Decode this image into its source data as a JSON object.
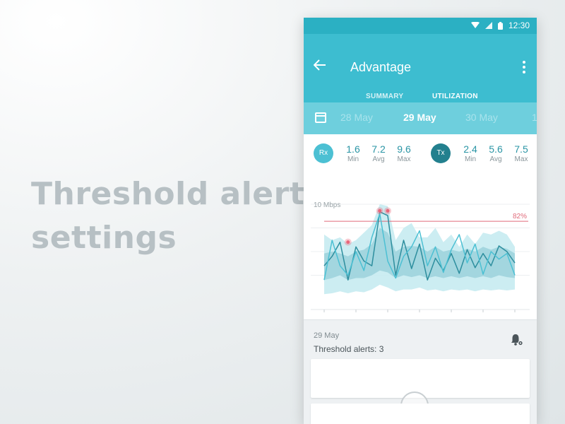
{
  "headline": {
    "line1": "Threshold alerts",
    "line2": "settings"
  },
  "status": {
    "time": "12:30",
    "icons": [
      "wifi-icon",
      "signal-icon",
      "battery-icon"
    ]
  },
  "appbar": {
    "title": "Advantage",
    "back_icon": "arrow-left-icon",
    "menu_icon": "more-vert-icon"
  },
  "tabs": [
    {
      "label": "SUMMARY",
      "active": false
    },
    {
      "label": "UTILIZATION",
      "active": true
    }
  ],
  "dates": {
    "prev": "28 May",
    "current": "29 May",
    "next": "30 May",
    "cut": "1"
  },
  "rx": {
    "badge": "Rx",
    "color": "#4cc0d3",
    "min": "1.6",
    "avg": "7.2",
    "max": "9.6"
  },
  "tx": {
    "badge": "Tx",
    "color": "#23808e",
    "min": "2.4",
    "avg": "5.6",
    "max": "7.5"
  },
  "stat_labels": {
    "min": "Min",
    "avg": "Avg",
    "max": "Max"
  },
  "chart_data": {
    "type": "area",
    "title": "",
    "ylabel": "10 Mbps",
    "x": [
      0,
      1,
      2,
      3,
      4,
      5,
      6,
      7,
      8,
      9,
      10,
      11,
      12,
      13,
      14,
      15,
      16,
      17,
      18,
      19,
      20,
      21,
      22,
      23,
      24
    ],
    "x_ticks": [
      0,
      4,
      8,
      12,
      16,
      20,
      24
    ],
    "ylim": [
      0,
      10
    ],
    "threshold": {
      "value": 8.2,
      "label": "82%",
      "color": "#e06a7a"
    },
    "series": [
      {
        "values": [
          3.5,
          4.5,
          6.0,
          2.0,
          5.5,
          4.0,
          3.5,
          9.2,
          8.8,
          2.5,
          6.2,
          3.2,
          5.8,
          2.0,
          4.3,
          3.0,
          4.8,
          2.7,
          5.2,
          3.3,
          4.8,
          3.5,
          5.6,
          5.0,
          3.8
        ]
      },
      {
        "values": [
          2.0,
          6.2,
          3.5,
          2.5,
          5.0,
          3.0,
          6.5,
          9.0,
          4.0,
          2.2,
          4.5,
          5.5,
          7.2,
          3.5,
          5.5,
          2.8,
          5.2,
          6.8,
          3.8,
          5.8,
          2.6,
          5.0,
          4.2,
          4.8,
          2.5
        ]
      }
    ],
    "band_outer_upper": [
      6.8,
      6.2,
      6.5,
      5.8,
      6.2,
      7.0,
      7.8,
      10.0,
      9.8,
      6.2,
      7.5,
      8.0,
      6.5,
      6.5,
      7.5,
      6.0,
      6.8,
      5.5,
      6.8,
      5.8,
      7.0,
      6.8,
      7.2,
      6.8,
      5.5
    ],
    "band_outer_lower": [
      0.5,
      0.6,
      0.8,
      0.6,
      0.8,
      0.7,
      1.0,
      1.5,
      1.2,
      0.8,
      1.0,
      1.0,
      1.2,
      0.9,
      1.0,
      0.8,
      1.0,
      0.9,
      1.0,
      0.8,
      1.0,
      0.9,
      1.0,
      0.9,
      1.0
    ],
    "band_inner_upper": [
      4.8,
      5.0,
      4.8,
      4.5,
      5.0,
      5.2,
      5.8,
      7.5,
      7.0,
      5.0,
      5.5,
      5.6,
      5.5,
      5.0,
      5.5,
      5.0,
      5.2,
      5.0,
      5.3,
      5.0,
      5.5,
      5.2,
      5.5,
      5.3,
      4.8
    ],
    "band_inner_lower": [
      2.0,
      2.2,
      2.5,
      2.0,
      2.2,
      2.2,
      2.5,
      3.0,
      2.8,
      2.2,
      2.5,
      2.3,
      2.5,
      2.2,
      2.4,
      2.2,
      2.4,
      2.2,
      2.4,
      2.2,
      2.4,
      2.2,
      2.5,
      2.3,
      2.2
    ],
    "alert_points": [
      {
        "x": 3,
        "y": 6.0
      },
      {
        "x": 7,
        "y": 9.3
      },
      {
        "x": 8,
        "y": 9.3
      }
    ],
    "colors": {
      "outer_band": "#c7ebf1",
      "inner_band": "#9fd3dd",
      "line1": "#2d8e9e",
      "line2": "#4cc0d3",
      "grid": "#eceff1",
      "alert": "#e9667a"
    }
  },
  "alerts": {
    "date": "29 May",
    "count_label": "Threshold alerts: 3",
    "bell_icon": "bell-settings-icon"
  }
}
